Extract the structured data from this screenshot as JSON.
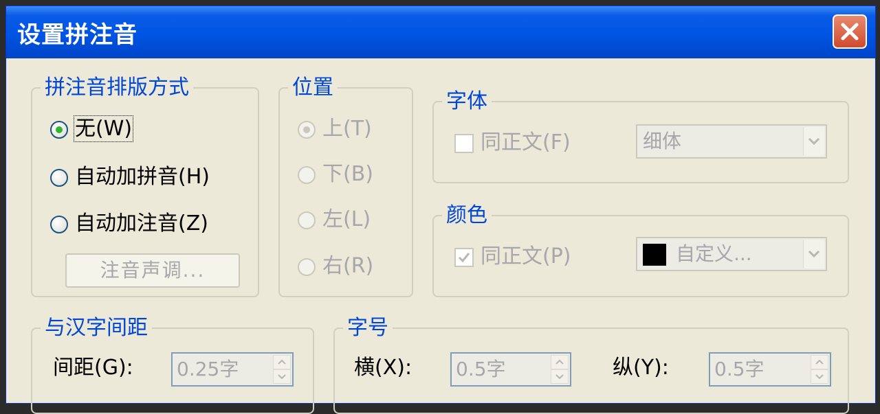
{
  "title": "设置拼注音",
  "layout_group": {
    "legend": "拼注音排版方式",
    "options": [
      "无(W)",
      "自动加拼音(H)",
      "自动加注音(Z)"
    ],
    "tone_button": "注音声调..."
  },
  "position_group": {
    "legend": "位置",
    "options": [
      "上(T)",
      "下(B)",
      "左(L)",
      "右(R)"
    ]
  },
  "font_group": {
    "legend": "字体",
    "same_as_body": "同正文(F)",
    "font_value": "细体"
  },
  "color_group": {
    "legend": "颜色",
    "same_as_body": "同正文(P)",
    "color_value": "自定义...",
    "swatch_color": "#000000"
  },
  "spacing_group": {
    "legend": "与汉字间距",
    "label": "间距(G):",
    "value": "0.25字"
  },
  "size_group": {
    "legend": "字号",
    "h_label": "横(X):",
    "h_value": "0.5字",
    "v_label": "纵(Y):",
    "v_value": "0.5字"
  }
}
